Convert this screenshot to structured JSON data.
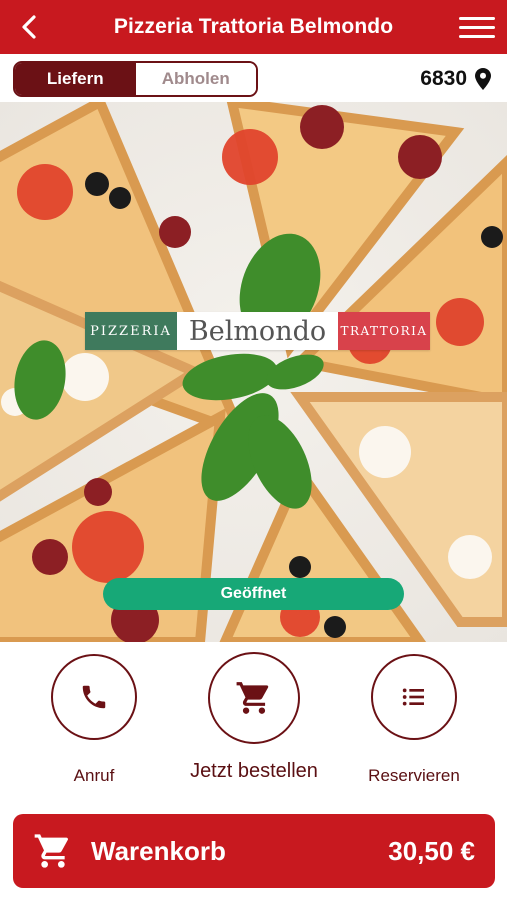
{
  "header": {
    "title": "Pizzeria Trattoria Belmondo",
    "back_icon": "chevron-left-icon",
    "menu_icon": "hamburger-menu-icon"
  },
  "order_mode": {
    "options": [
      "Liefern",
      "Abholen"
    ],
    "selected": "Liefern"
  },
  "location": {
    "postal_code": "6830",
    "icon": "map-pin-icon"
  },
  "logo": {
    "left": "PIZZERIA",
    "center": "Belmondo",
    "right": "TRATTORIA"
  },
  "status": {
    "label": "Geöffnet",
    "color": "#17a877"
  },
  "actions": [
    {
      "label": "Anruf",
      "icon": "phone-icon"
    },
    {
      "label": "Jetzt bestellen",
      "icon": "shopping-cart-icon"
    },
    {
      "label": "Reservieren",
      "icon": "list-icon"
    }
  ],
  "cart": {
    "label": "Warenkorb",
    "total": "30,50 €",
    "icon": "shopping-cart-icon"
  },
  "colors": {
    "brand_red": "#c8191f",
    "dark_maroon": "#6b1115",
    "open_green": "#17a877"
  }
}
